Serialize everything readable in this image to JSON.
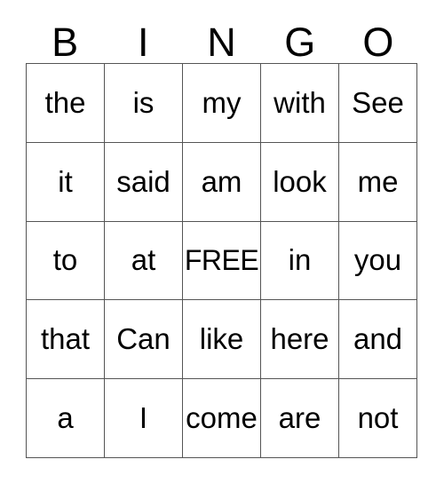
{
  "card": {
    "title": "BINGO",
    "headers": [
      "B",
      "I",
      "N",
      "G",
      "O"
    ],
    "free_space_label": "FREE",
    "colors": {
      "background": "#ffffff",
      "text": "#000000",
      "grid_line": "#555555"
    },
    "rows": [
      {
        "cells": [
          "the",
          "is",
          "my",
          "with",
          "See"
        ]
      },
      {
        "cells": [
          "it",
          "said",
          "am",
          "look",
          "me"
        ]
      },
      {
        "cells": [
          "to",
          "at",
          "FREE",
          "in",
          "you"
        ]
      },
      {
        "cells": [
          "that",
          "Can",
          "like",
          "here",
          "and"
        ]
      },
      {
        "cells": [
          "a",
          "I",
          "come",
          "are",
          "not"
        ]
      }
    ]
  }
}
